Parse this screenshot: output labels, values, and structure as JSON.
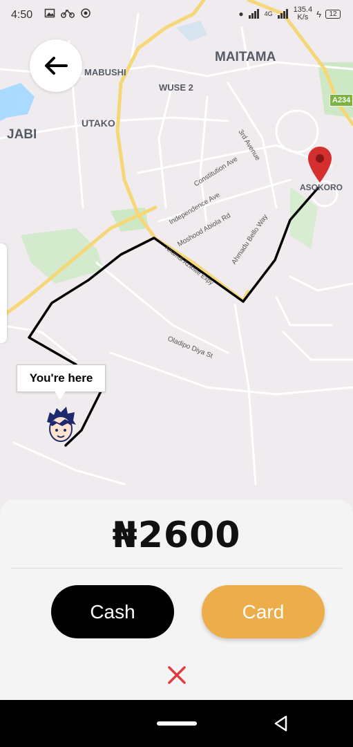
{
  "status_bar": {
    "time": "4:50",
    "network": "4G",
    "speed_value": "135.4",
    "speed_unit": "K/s",
    "battery": "12"
  },
  "map": {
    "labels": {
      "maitama": "MAITAMA",
      "mabushi": "MABUSHI",
      "wuse2": "WUSE 2",
      "jabi": "JABI",
      "utako": "UTAKO",
      "asokoro": "ASOKORO",
      "highway_badge": "A234"
    },
    "streets": {
      "third_avenue": "3rd Avenue",
      "constitution": "Constitution Ave",
      "independence": "Independence Ave",
      "moshood": "Moshood Abiola Rd",
      "ahmadu": "Ahmadu Bello Way",
      "nnamdi": "Nnamdi Azikiwe Expy",
      "oladipo": "Oladipo Diya St"
    },
    "you_are_here": "You're here",
    "icons": [
      "arrow-left-icon",
      "location-pin-icon",
      "user-avatar-icon"
    ],
    "colors": {
      "route": "#000000",
      "major_road": "#f6d777",
      "pin": "#d32f2f",
      "water": "#aadaff",
      "park": "#cde8c4"
    }
  },
  "booking": {
    "price": "₦2600",
    "cash_label": "Cash",
    "card_label": "Card",
    "colors": {
      "cash_bg": "#000000",
      "card_bg": "#ecad4a",
      "cancel": "#e53935"
    }
  }
}
